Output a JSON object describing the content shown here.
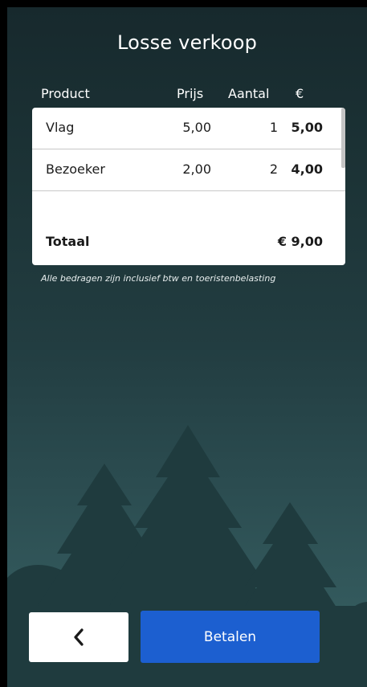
{
  "page": {
    "title": "Losse verkoop"
  },
  "columns": {
    "product": "Product",
    "price": "Prijs",
    "quantity": "Aantal",
    "currency": "€"
  },
  "items": [
    {
      "name": "Vlag",
      "price": "5,00",
      "quantity": "1",
      "total": "5,00"
    },
    {
      "name": "Bezoeker",
      "price": "2,00",
      "quantity": "2",
      "total": "4,00"
    }
  ],
  "totals": {
    "label": "Totaal",
    "value": "€ 9,00"
  },
  "note": "Alle bedragen zijn inclusief btw en toeristenbelasting",
  "actions": {
    "back_icon": "chevron-left-icon",
    "pay_label": "Betalen"
  },
  "colors": {
    "background_top": "#17292d",
    "background_bottom": "#385f62",
    "tree_color": "#1f3b3e",
    "pay_button": "#1c5fd0",
    "card": "#ffffff"
  }
}
